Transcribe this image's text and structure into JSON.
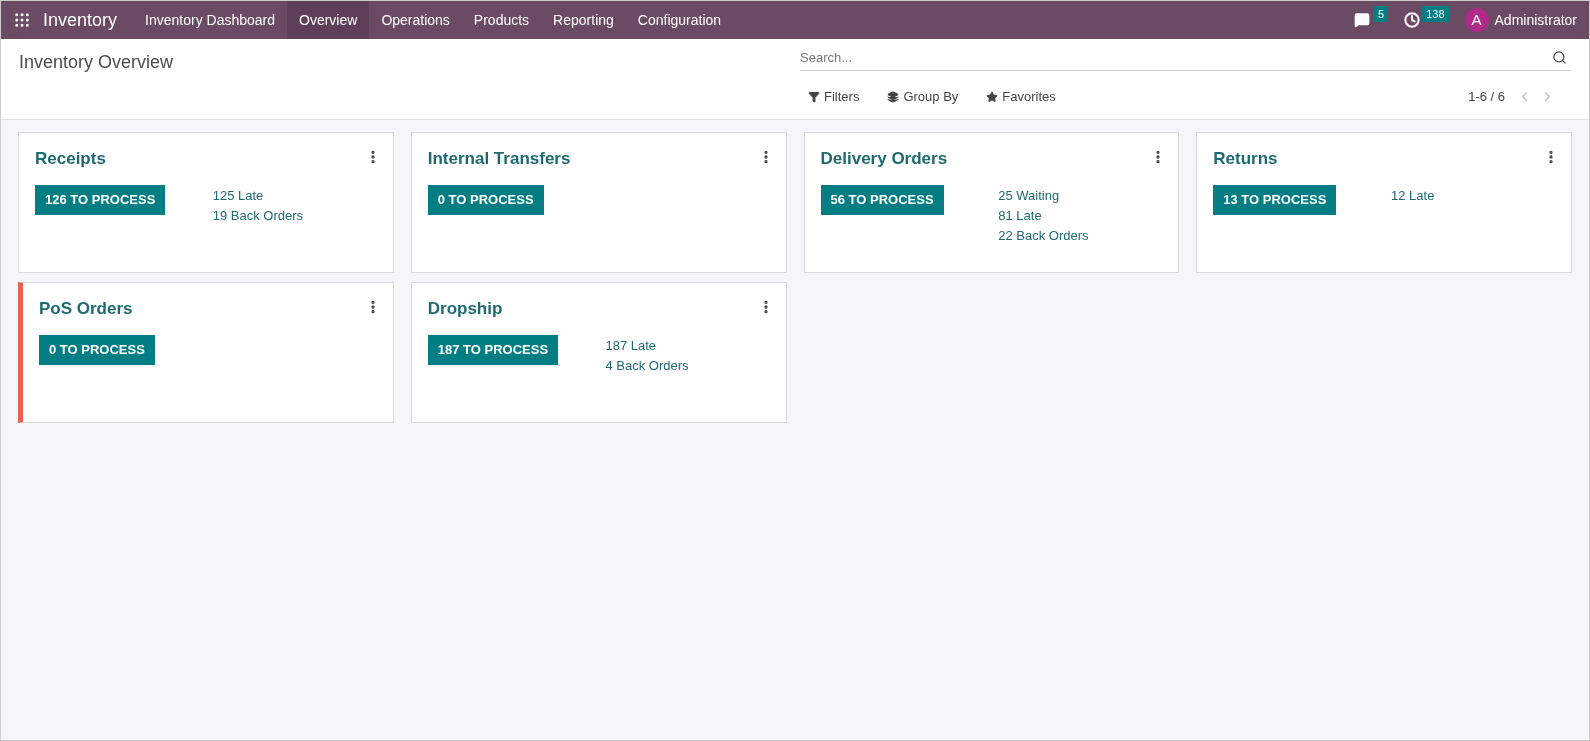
{
  "navbar": {
    "app_name": "Inventory",
    "menu": [
      {
        "label": "Inventory Dashboard",
        "selected": false
      },
      {
        "label": "Overview",
        "selected": true
      },
      {
        "label": "Operations",
        "selected": false
      },
      {
        "label": "Products",
        "selected": false
      },
      {
        "label": "Reporting",
        "selected": false
      },
      {
        "label": "Configuration",
        "selected": false
      }
    ],
    "messages_count": "5",
    "activities_count": "138",
    "user": {
      "initial": "A",
      "name": "Administrator"
    }
  },
  "control_panel": {
    "title": "Inventory Overview",
    "search": {
      "placeholder": "Search..."
    },
    "filters": [
      "Filters",
      "Group By",
      "Favorites"
    ],
    "pager": "1-6 / 6"
  },
  "cards": [
    {
      "title": "Receipts",
      "button": "126 TO PROCESS",
      "links": [
        "125 Late",
        "19 Back Orders"
      ]
    },
    {
      "title": "Internal Transfers",
      "button": "0 TO PROCESS"
    },
    {
      "title": "Delivery Orders",
      "button": "56 TO PROCESS",
      "links": [
        "25 Waiting",
        "81 Late",
        "22 Back Orders"
      ]
    },
    {
      "title": "Returns",
      "button": "13 TO PROCESS",
      "links": [
        "12 Late"
      ]
    },
    {
      "title": "PoS Orders",
      "button": "0 TO PROCESS",
      "color": "#f06050"
    },
    {
      "title": "Dropship",
      "button": "187 TO PROCESS",
      "links": [
        "187 Late",
        "4 Back Orders"
      ]
    }
  ]
}
